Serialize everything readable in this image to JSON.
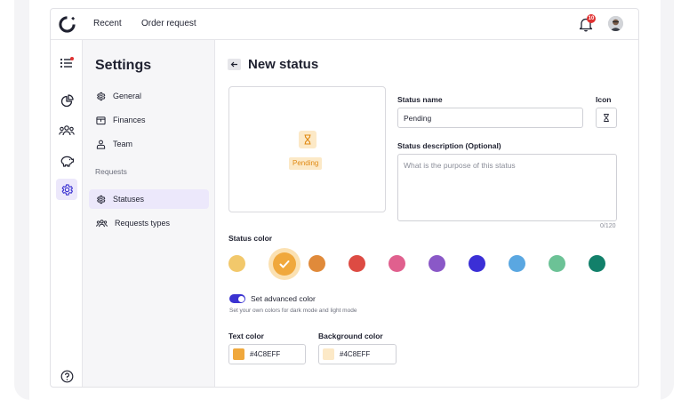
{
  "topbar": {
    "nav": [
      "Recent",
      "Order request"
    ],
    "notification_count": "10"
  },
  "settings_nav": {
    "title": "Settings",
    "items": [
      {
        "label": "General",
        "icon": "gear-icon"
      },
      {
        "label": "Finances",
        "icon": "wallet-icon"
      },
      {
        "label": "Team",
        "icon": "team-icon"
      }
    ],
    "section_label": "Requests",
    "request_items": [
      {
        "label": "Statuses",
        "icon": "gear-icon",
        "active": true
      },
      {
        "label": "Requests types",
        "icon": "people-icon"
      }
    ]
  },
  "main": {
    "page_title": "New status",
    "preview_label": "Pending",
    "status_name_label": "Status name",
    "status_name_value": "Pending",
    "icon_label": "Icon",
    "icon_value": "hourglass-icon",
    "description_label": "Status description (Optional)",
    "description_placeholder": "What is the purpose of this status",
    "char_counter": "0/120",
    "status_color_label": "Status color",
    "swatches": [
      "#f2c86b",
      "#f0a83c",
      "#e08a3a",
      "#dd4b43",
      "#e0608e",
      "#8a58c7",
      "#3b2fd6",
      "#5aa7e1",
      "#6cc296",
      "#12806a"
    ],
    "selected_swatch_index": 1,
    "advanced_toggle_label": "Set advanced color",
    "advanced_toggle_on": true,
    "advanced_hint": "Set your own colors for dark mode and light mode",
    "text_color_label": "Text color",
    "text_color_value": "#4C8EFF",
    "text_color_chip": "#f0a83c",
    "bg_color_label": "Background color",
    "bg_color_value": "#4C8EFF",
    "bg_color_chip": "#fce9c7"
  },
  "colors": {
    "accent": "#3b33d1",
    "active_bg": "#ece8fb",
    "notification": "#e03131"
  }
}
